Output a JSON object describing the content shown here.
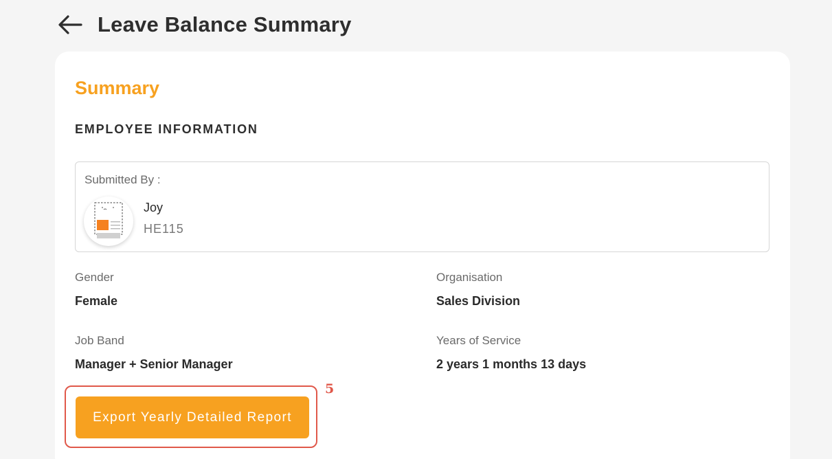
{
  "header": {
    "title": "Leave Balance Summary"
  },
  "summary": {
    "title": "Summary",
    "section_heading": "EMPLOYEE INFORMATION",
    "submitted_by_label": "Submitted By :",
    "employee": {
      "name": "Joy",
      "id": "HE115"
    },
    "fields": {
      "gender": {
        "label": "Gender",
        "value": "Female"
      },
      "organisation": {
        "label": "Organisation",
        "value": "Sales Division"
      },
      "job_band": {
        "label": "Job Band",
        "value": "Manager + Senior Manager"
      },
      "years_of_service": {
        "label": "Years of Service",
        "value": "2 years 1 months 13 days"
      }
    },
    "export_button_label": "Export Yearly Detailed Report"
  },
  "annotation": {
    "number": "5"
  },
  "colors": {
    "accent": "#f7a120",
    "annotation": "#e0584a",
    "background": "#f5f5f5"
  },
  "icons": {
    "back": "arrow-left-icon",
    "avatar": "avatar-placeholder-icon"
  }
}
